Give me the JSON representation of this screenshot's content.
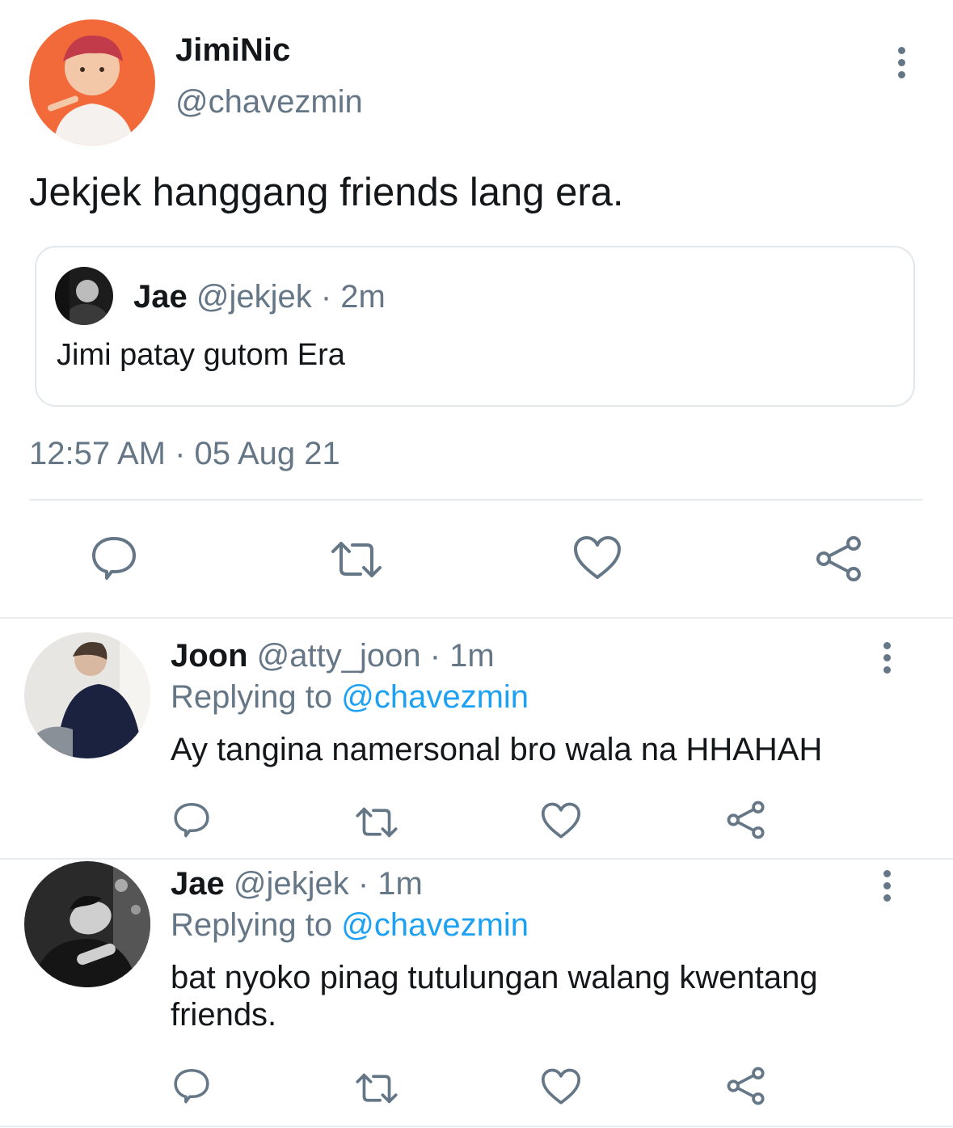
{
  "main_tweet": {
    "display_name": "JimiNic",
    "handle": "@chavezmin",
    "text": "Jekjek hanggang friends lang era.",
    "timestamp": "12:57 AM · 05 Aug 21",
    "quoted": {
      "display_name": "Jae",
      "handle": "@jekjek",
      "time": "· 2m",
      "text": "Jimi patay gutom Era"
    }
  },
  "replies": [
    {
      "display_name": "Joon",
      "handle": "@atty_joon",
      "time": "· 1m",
      "replying_label": "Replying to",
      "replying_to": "@chavezmin",
      "text": "Ay tangina namersonal bro wala na HHAHAH"
    },
    {
      "display_name": "Jae",
      "handle": "@jekjek",
      "time": "· 1m",
      "replying_label": "Replying to",
      "replying_to": "@chavezmin",
      "text": "bat nyoko pinag tutulungan walang kwentang friends."
    }
  ],
  "icons": {
    "reply": "reply-icon",
    "retweet": "retweet-icon",
    "like": "heart-icon",
    "share": "share-icon",
    "more": "more-vertical-icon"
  },
  "colors": {
    "link": "#1da1f2",
    "muted": "#657786",
    "text": "#14171a",
    "divider": "#e6ecf0"
  }
}
